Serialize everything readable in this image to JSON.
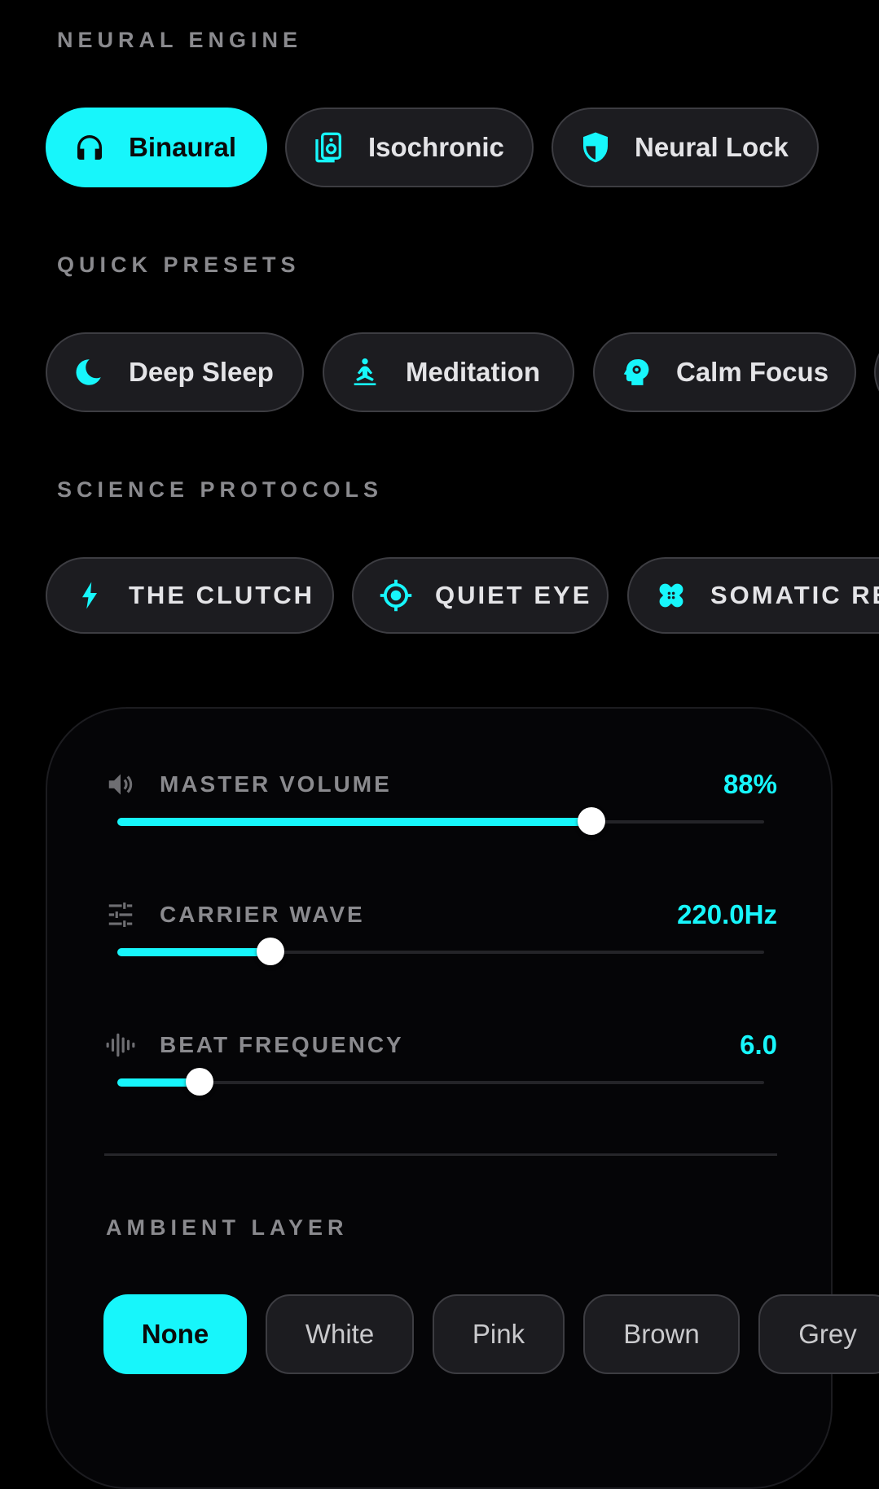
{
  "neural_engine": {
    "label": "NEURAL ENGINE",
    "modes": [
      {
        "label": "Binaural",
        "icon": "headphones-icon",
        "active": true
      },
      {
        "label": "Isochronic",
        "icon": "speaker-icon",
        "active": false
      },
      {
        "label": "Neural Lock",
        "icon": "shield-icon",
        "active": false
      }
    ]
  },
  "quick_presets": {
    "label": "QUICK PRESETS",
    "items": [
      {
        "label": "Deep Sleep",
        "icon": "moon-icon"
      },
      {
        "label": "Meditation",
        "icon": "meditation-icon"
      },
      {
        "label": "Calm Focus",
        "icon": "head-gear-icon"
      }
    ]
  },
  "science_protocols": {
    "label": "SCIENCE PROTOCOLS",
    "items": [
      {
        "label": "THE CLUTCH",
        "icon": "bolt-icon"
      },
      {
        "label": "QUIET EYE",
        "icon": "target-icon"
      },
      {
        "label": "SOMATIC RE",
        "icon": "bandage-icon"
      }
    ]
  },
  "controls": {
    "master_volume": {
      "label": "MASTER VOLUME",
      "value": "88%",
      "level": 0.733,
      "icon": "volume-icon"
    },
    "carrier_wave": {
      "label": "CARRIER WAVE",
      "value": "220.0Hz",
      "level": 0.237,
      "icon": "sliders-icon"
    },
    "beat_frequency": {
      "label": "BEAT FREQUENCY",
      "value": "6.0",
      "level": 0.127,
      "icon": "waveform-icon"
    }
  },
  "ambient_layer": {
    "label": "AMBIENT LAYER",
    "options": [
      {
        "label": "None",
        "active": true
      },
      {
        "label": "White",
        "active": false
      },
      {
        "label": "Pink",
        "active": false
      },
      {
        "label": "Brown",
        "active": false
      },
      {
        "label": "Grey",
        "active": false
      }
    ]
  },
  "colors": {
    "accent": "#17f6fb",
    "background": "#000000",
    "pill_bg": "#1c1c20",
    "muted_text": "#8a8a8e"
  }
}
